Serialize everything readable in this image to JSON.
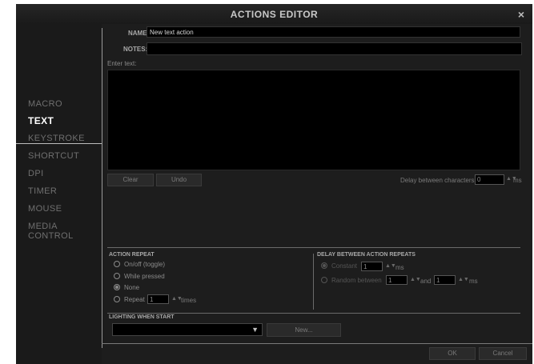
{
  "window": {
    "title": "ACTIONS EDITOR",
    "close_glyph": "×"
  },
  "sidebar": {
    "items": [
      {
        "label": "MACRO",
        "active": false
      },
      {
        "label": "TEXT",
        "active": true
      },
      {
        "label": "KEYSTROKE",
        "active": false
      },
      {
        "label": "SHORTCUT",
        "active": false
      },
      {
        "label": "DPI",
        "active": false
      },
      {
        "label": "TIMER",
        "active": false
      },
      {
        "label": "MOUSE",
        "active": false
      },
      {
        "label": "MEDIA CONTROL",
        "active": false
      }
    ]
  },
  "form": {
    "name_label": "NAME:",
    "name_value": "New text action",
    "notes_label": "NOTES:",
    "notes_value": "",
    "enter_text_label": "Enter text:",
    "text_value": ""
  },
  "text_buttons": {
    "clear": "Clear",
    "undo": "Undo"
  },
  "delay_chars": {
    "label": "Delay between characters",
    "value": "0",
    "unit": "ms"
  },
  "action_repeat": {
    "title": "ACTION REPEAT",
    "options": [
      {
        "label": "On/off (toggle)",
        "selected": false
      },
      {
        "label": "While pressed",
        "selected": false
      },
      {
        "label": "None",
        "selected": true
      },
      {
        "label": "Repeat",
        "selected": false
      }
    ],
    "repeat_count": "1",
    "repeat_unit": "times"
  },
  "delay_repeats": {
    "title": "DELAY BETWEEN ACTION REPEATS",
    "constant_label": "Constant",
    "constant_value": "1",
    "constant_unit": "ms",
    "constant_selected": true,
    "random_label": "Random between",
    "random_from": "1",
    "and_label": "and",
    "random_to": "1",
    "random_unit": "ms",
    "random_selected": false
  },
  "lighting": {
    "title": "LIGHTING WHEN START",
    "selected": "",
    "new_button": "New..."
  },
  "footer": {
    "ok": "OK",
    "cancel": "Cancel"
  },
  "icons": {
    "close": "close-icon",
    "dropdown": "chevron-down-icon",
    "spin": "spinner-arrows-icon"
  }
}
